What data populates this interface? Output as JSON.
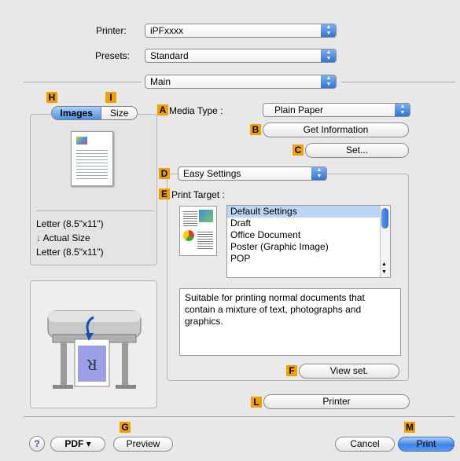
{
  "printer": {
    "label": "Printer:",
    "value": "iPFxxxx"
  },
  "presets": {
    "label": "Presets:",
    "value": "Standard"
  },
  "panel_select": {
    "value": "Main"
  },
  "markers": {
    "A": "A",
    "B": "B",
    "C": "C",
    "D": "D",
    "E": "E",
    "F": "F",
    "G": "G",
    "H": "H",
    "I": "I",
    "L": "L",
    "M": "M"
  },
  "left_tabs": {
    "images": "Images",
    "size": "Size"
  },
  "preview_info": {
    "paper_size": "Letter (8.5\"x11\")",
    "scaling": "Actual Size",
    "output_size": "Letter (8.5\"x11\")"
  },
  "media_type": {
    "label": "Media Type :",
    "value": "Plain Paper"
  },
  "buttons": {
    "get_info": "Get Information",
    "set": "Set...",
    "view_set": "View set.",
    "printer": "Printer",
    "pdf": "PDF ▾",
    "preview": "Preview",
    "cancel": "Cancel",
    "print": "Print",
    "help": "?"
  },
  "easy_settings": {
    "value": "Easy Settings"
  },
  "print_target": {
    "label": "Print Target :",
    "items": [
      "Default Settings",
      "Draft",
      "Office Document",
      "Poster (Graphic Image)",
      "POP"
    ],
    "selected_index": 0
  },
  "description": "Suitable for printing normal documents that contain a mixture of text, photographs and graphics."
}
